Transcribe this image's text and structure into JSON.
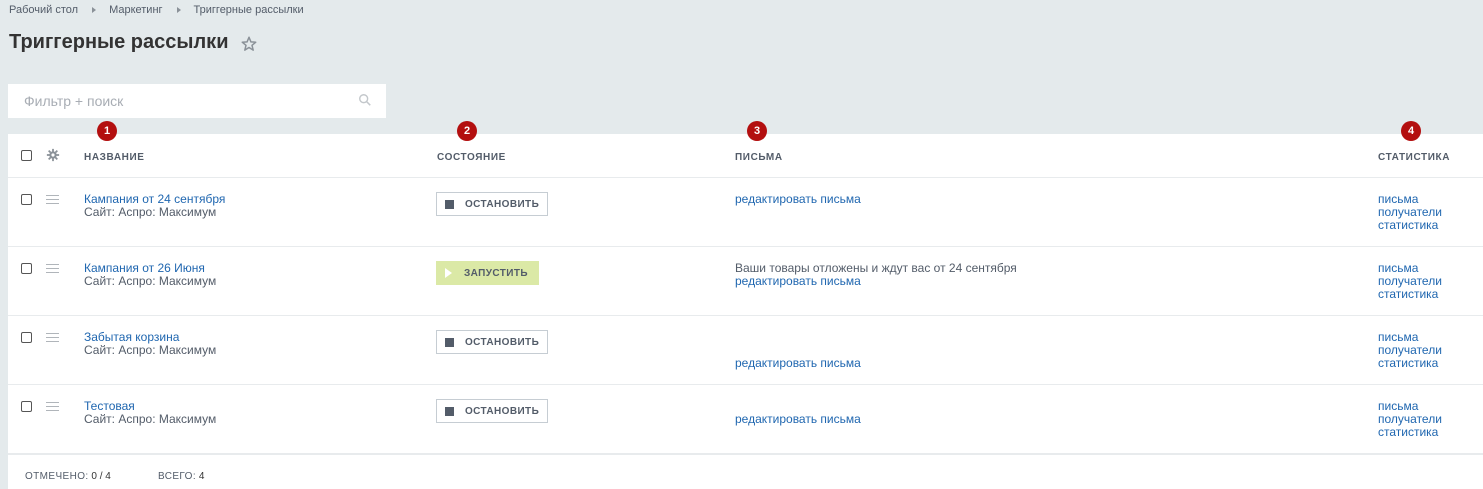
{
  "breadcrumb": [
    "Рабочий стол",
    "Маркетинг",
    "Триггерные рассылки"
  ],
  "page_title": "Триггерные рассылки",
  "search": {
    "placeholder": "Фильтр + поиск"
  },
  "columns": {
    "name": "НАЗВАНИЕ",
    "state": "СОСТОЯНИЕ",
    "letters": "ПИСЬМА",
    "stats": "СТАТИСТИКА"
  },
  "badges": [
    "1",
    "2",
    "3",
    "4"
  ],
  "rows": [
    {
      "title": "Кампания от 24 сентября",
      "site": "Сайт: Аспро: Максимум",
      "button": "ОСТАНОВИТЬ",
      "letter_text": "",
      "letter_link": "редактировать письма",
      "stats": [
        "письма",
        "получатели",
        "статистика"
      ]
    },
    {
      "title": "Кампания от 26 Июня",
      "site": "Сайт: Аспро: Максимум",
      "button": "ЗАПУСТИТЬ",
      "letter_text": "Ваши товары отложены и ждут вас от 24 сентября",
      "letter_link": "редактировать письма",
      "stats": [
        "письма",
        "получатели",
        "статистика"
      ]
    },
    {
      "title": "Забытая корзина",
      "site": "Сайт: Аспро: Максимум",
      "button": "ОСТАНОВИТЬ",
      "letter_text": "",
      "letter_link": "редактировать письма",
      "stats": [
        "письма",
        "получатели",
        "статистика"
      ]
    },
    {
      "title": "Тестовая",
      "site": "Сайт: Аспро: Максимум",
      "button": "ОСТАНОВИТЬ",
      "letter_text": "",
      "letter_link": "редактировать письма",
      "stats": [
        "письма",
        "получатели",
        "статистика"
      ]
    }
  ],
  "footer": {
    "checked_label": "ОТМЕЧЕНО:",
    "checked_value": "0 / 4",
    "total_label": "ВСЕГО:",
    "total_value": "4"
  },
  "colors": {
    "background": "#e4eaec",
    "link": "#2067b0",
    "badge": "#b30f0f",
    "start_button": "#dbe9a6"
  }
}
